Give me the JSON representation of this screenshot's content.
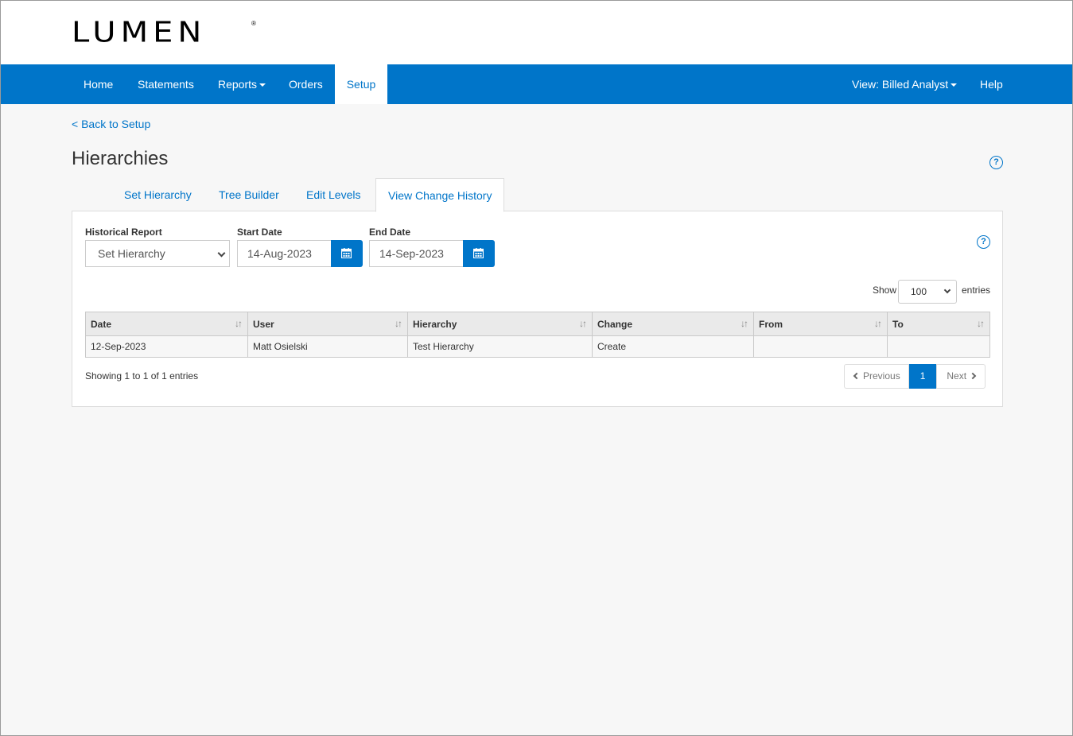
{
  "brand": {
    "logo_text": "LUMEN",
    "logo_mark": "®"
  },
  "nav": {
    "items": [
      {
        "label": "Home"
      },
      {
        "label": "Statements"
      },
      {
        "label": "Reports"
      },
      {
        "label": "Orders"
      },
      {
        "label": "Setup",
        "active": true
      }
    ],
    "view_label": "View: Billed Analyst",
    "help_label": "Help"
  },
  "back_link": "< Back to Setup",
  "page_title": "Hierarchies",
  "help_icon_glyph": "?",
  "tabs": [
    {
      "label": "Set Hierarchy"
    },
    {
      "label": "Tree Builder"
    },
    {
      "label": "Edit Levels"
    },
    {
      "label": "View Change History",
      "active": true
    }
  ],
  "filters": {
    "historical_report_label": "Historical Report",
    "historical_report_value": "Set Hierarchy",
    "start_date_label": "Start Date",
    "start_date_value": "14-Aug-2023",
    "end_date_label": "End Date",
    "end_date_value": "14-Sep-2023"
  },
  "length": {
    "show_label": "Show",
    "value": "100",
    "entries_label": "entries"
  },
  "table": {
    "columns": [
      "Date",
      "User",
      "Hierarchy",
      "Change",
      "From",
      "To"
    ],
    "sort_glyph": "↓↑",
    "rows": [
      [
        "12-Sep-2023",
        "Matt Osielski",
        "Test Hierarchy",
        "Create",
        "",
        ""
      ]
    ]
  },
  "info": "Showing 1 to 1 of 1 entries",
  "pagination": {
    "previous": "Previous",
    "current": "1",
    "next": "Next"
  },
  "colors": {
    "accent": "#0075c9",
    "background": "#f7f7f7"
  },
  "icons": [
    "calendar-icon",
    "help-icon",
    "chevron-down-icon",
    "sort-icon",
    "chevron-left-icon",
    "chevron-right-icon"
  ]
}
